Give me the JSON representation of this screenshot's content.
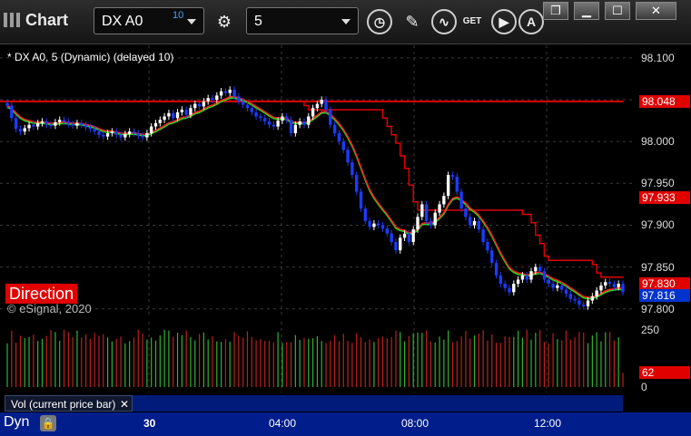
{
  "window": {
    "title": "Chart",
    "symbol": "DX A0",
    "symbol_sup": "10",
    "interval": "5",
    "buttons": [
      "restore-icon",
      "minimize-icon",
      "maximize-icon",
      "close-icon"
    ],
    "toolbar_icons": [
      "settings-gear-icon",
      "clock-icon",
      "pencil-icon",
      "study-icon",
      "get-icon",
      "play-icon",
      "alert-icon"
    ],
    "get_label": "GET"
  },
  "chart_data": {
    "type": "candlestick",
    "title": "* DX A0, 5 (Dynamic) (delayed 10)",
    "y_ticks": [
      "98.100",
      "98.050",
      "98.000",
      "97.950",
      "97.900",
      "97.850",
      "97.800"
    ],
    "ylim": [
      97.79,
      98.115
    ],
    "x_ticks": [
      "30",
      "04:00",
      "08:00",
      "12:00"
    ],
    "price_tags": [
      {
        "value": "98.048",
        "color": "#e00000"
      },
      {
        "value": "97.933",
        "color": "#e00000"
      },
      {
        "value": "97.830",
        "color": "#e00000"
      },
      {
        "value": "97.816",
        "color": "#0033cc"
      }
    ],
    "close_values": [
      98.043,
      98.028,
      98.015,
      98.012,
      98.016,
      98.02,
      98.018,
      98.022,
      98.024,
      98.02,
      98.019,
      98.023,
      98.026,
      98.024,
      98.021,
      98.019,
      98.022,
      98.02,
      98.017,
      98.015,
      98.012,
      98.008,
      98.006,
      98.01,
      98.012,
      98.008,
      98.005,
      98.009,
      98.012,
      98.01,
      98.007,
      98.005,
      98.01,
      98.018,
      98.022,
      98.026,
      98.03,
      98.034,
      98.028,
      98.035,
      98.038,
      98.032,
      98.04,
      98.045,
      98.042,
      98.048,
      98.052,
      98.05,
      98.055,
      98.06,
      98.058,
      98.062,
      98.054,
      98.048,
      98.044,
      98.04,
      98.035,
      98.03,
      98.028,
      98.024,
      98.02,
      98.018,
      98.025,
      98.03,
      98.026,
      98.01,
      98.02,
      98.024,
      98.02,
      98.03,
      98.04,
      98.045,
      98.05,
      98.038,
      98.02,
      98.01,
      98.0,
      97.99,
      97.975,
      97.96,
      97.94,
      97.92,
      97.905,
      97.898,
      97.902,
      97.9,
      97.896,
      97.89,
      97.88,
      97.87,
      97.885,
      97.89,
      97.88,
      97.895,
      97.91,
      97.925,
      97.905,
      97.9,
      97.915,
      97.925,
      97.935,
      97.96,
      97.958,
      97.94,
      97.92,
      97.91,
      97.9,
      97.905,
      97.895,
      97.88,
      97.87,
      97.855,
      97.84,
      97.83,
      97.825,
      97.82,
      97.83,
      97.835,
      97.84,
      97.835,
      97.845,
      97.85,
      97.845,
      97.835,
      97.83,
      97.825,
      97.828,
      97.823,
      97.818,
      97.812,
      97.81,
      97.805,
      97.803,
      97.81,
      97.815,
      97.822,
      97.828,
      97.832,
      97.83,
      97.826,
      97.83,
      97.82
    ],
    "series": [
      {
        "name": "red-moving-average",
        "color": "#ff2020"
      },
      {
        "name": "green-moving-average",
        "color": "#20e020"
      },
      {
        "name": "red-step-line",
        "color": "#e00000"
      }
    ],
    "volume": {
      "title": "Vol (current price bar)",
      "y_ticks": [
        "250",
        "62",
        "0"
      ],
      "ylim": [
        0,
        260
      ],
      "current_value": "62"
    }
  },
  "labels": {
    "direction": "Direction",
    "copyright": "© eSignal, 2020",
    "dyn": "Dyn"
  }
}
